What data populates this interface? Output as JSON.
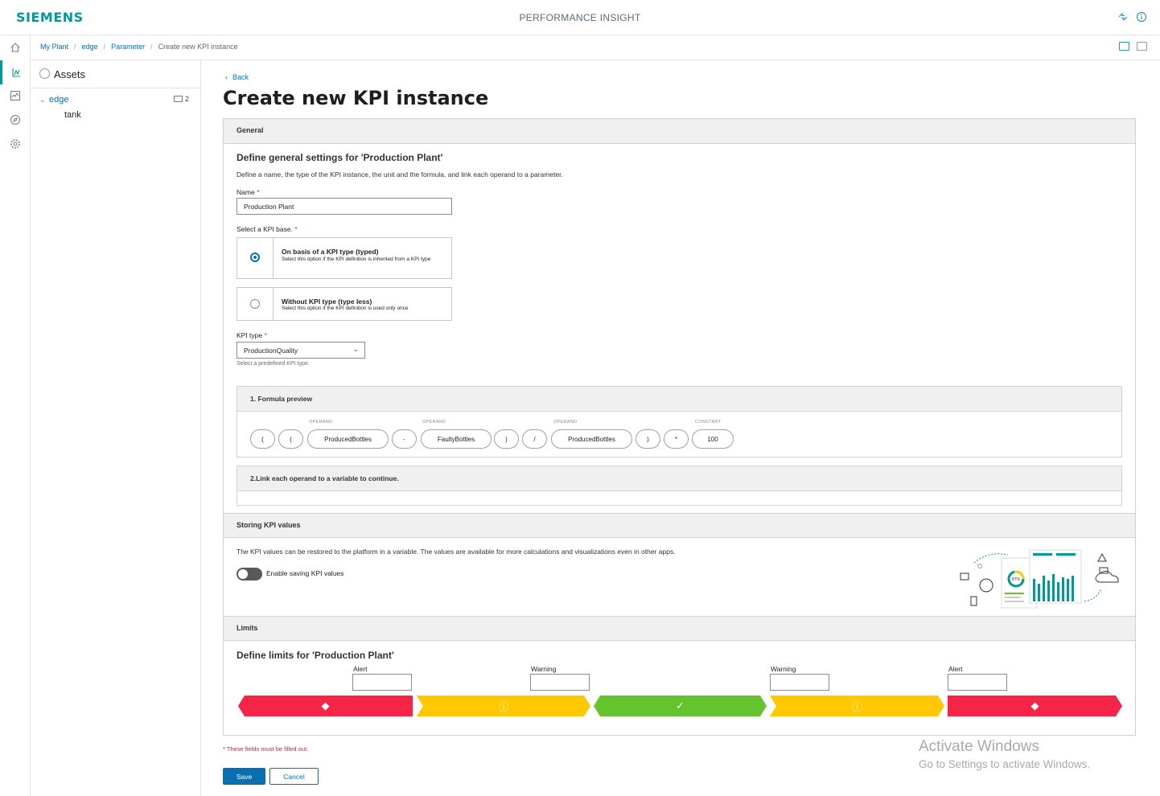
{
  "header": {
    "brand": "SIEMENS",
    "app_title": "PERFORMANCE INSIGHT",
    "icons": [
      "settings-sync-icon",
      "info-icon"
    ]
  },
  "rail": {
    "items": [
      "home-icon",
      "kpi-icon",
      "trend-icon",
      "compass-icon",
      "gear-icon"
    ],
    "active": "kpi-icon"
  },
  "breadcrumb": {
    "items": [
      "My Plant",
      "edge",
      "Parameter"
    ],
    "current": "Create new KPI instance"
  },
  "tree": {
    "title": "Assets",
    "root": "edge",
    "root_count": "2",
    "child": "tank"
  },
  "page": {
    "back": "Back",
    "title": "Create new KPI instance"
  },
  "general": {
    "section": "General",
    "heading": "Define general settings for 'Production Plant'",
    "description": "Define a name, the type of the KPI instance, the unit and the formula, and link each operand to a parameter.",
    "name_label": "Name",
    "name_value": "Production Plant",
    "base_label": "Select a KPI base.",
    "options": [
      {
        "title": "On basis of a KPI type (typed)",
        "desc": "Select this option if the KPI definition is inherited from a KPI type",
        "selected": true
      },
      {
        "title": "Without KPI type (type less)",
        "desc": "Select this option if the KPI definition is used only once",
        "selected": false
      }
    ],
    "type_label": "KPI type",
    "type_value": "ProductionQuality",
    "type_hint": "Select a predefined KPI type."
  },
  "formula": {
    "title": "1. Formula preview",
    "operand_label": "OPERAND",
    "constant_label": "CONSTANT",
    "tokens": [
      "(",
      "(",
      "ProducedBottles",
      "-",
      "FaultyBottles",
      ")",
      "/",
      "ProducedBottles",
      ")",
      "*",
      "100"
    ]
  },
  "link": {
    "title": "2.Link each operand to a variable to continue."
  },
  "storing": {
    "section": "Storing KPI values",
    "description": "The KPI values can be restored to the platform in a variable. The values are available for more calculations and visualizations even in other apps.",
    "toggle_label": "Enable saving KPI values",
    "toggle_on": false,
    "illustration_value": "87%"
  },
  "limits": {
    "section": "Limits",
    "heading": "Define limits for 'Production Plant'",
    "labels": [
      "Alert",
      "Warning",
      "Warning",
      "Alert"
    ],
    "colors": {
      "alert": "#f62447",
      "warning": "#ffc800",
      "ok": "#65c42e"
    }
  },
  "footer": {
    "required_note": "* These fields must be filled out.",
    "save": "Save",
    "cancel": "Cancel"
  },
  "watermark": {
    "line1": "Activate Windows",
    "line2": "Go to Settings to activate Windows."
  }
}
